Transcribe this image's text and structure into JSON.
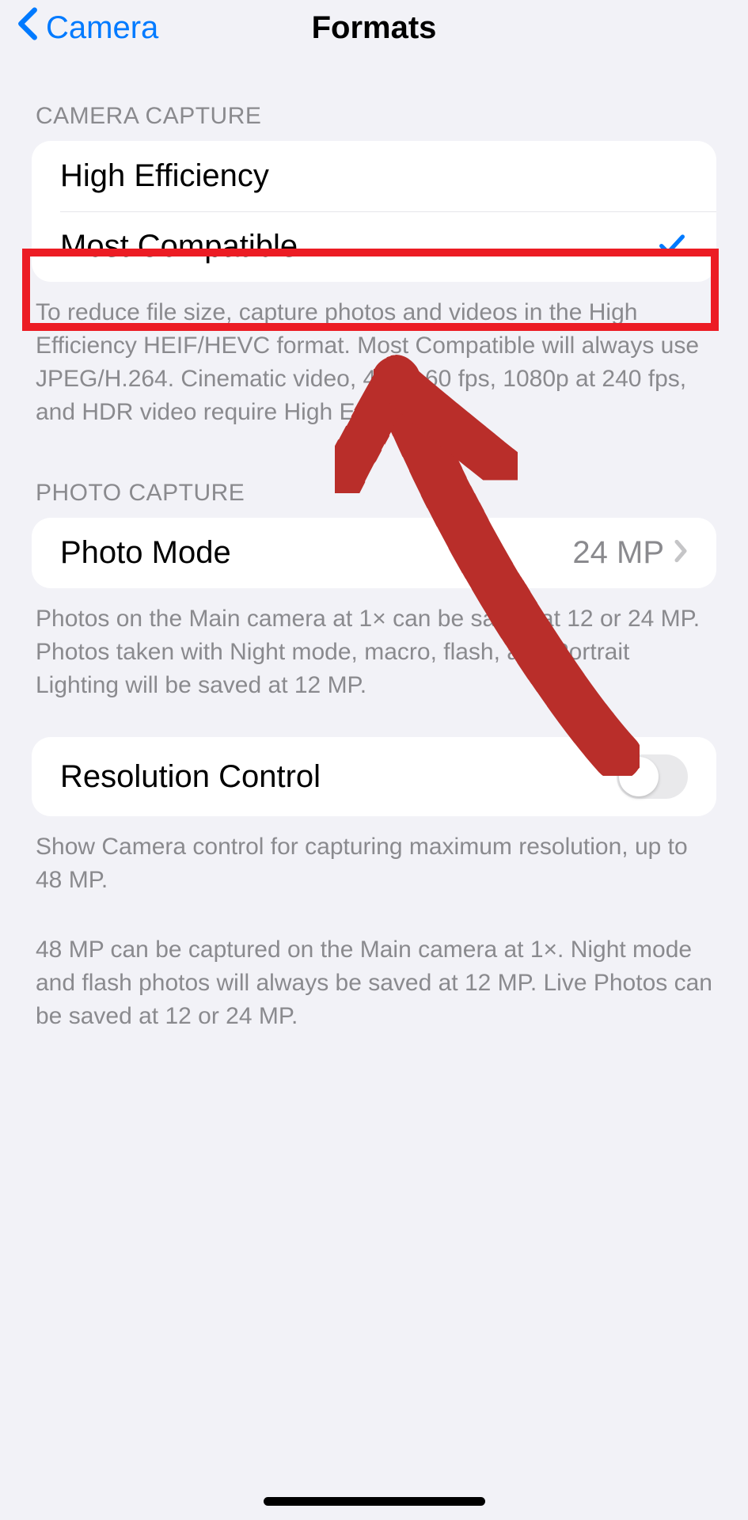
{
  "nav": {
    "back_label": "Camera",
    "title": "Formats"
  },
  "sections": {
    "cameraCapture": {
      "header": "CAMERA CAPTURE",
      "option_high_efficiency": "High Efficiency",
      "option_most_compatible": "Most Compatible",
      "footer": "To reduce file size, capture photos and videos in the High Efficiency HEIF/HEVC format. Most Compatible will always use JPEG/H.264. Cinematic video, 4K at 60 fps, 1080p at 240 fps, and HDR video require High Efficiency."
    },
    "photoCapture": {
      "header": "PHOTO CAPTURE",
      "photo_mode_label": "Photo Mode",
      "photo_mode_value": "24 MP",
      "footer": "Photos on the Main camera at 1× can be saved at 12 or 24 MP. Photos taken with Night mode, macro, flash, and Portrait Lighting will be saved at 12 MP."
    },
    "resolution": {
      "label": "Resolution Control",
      "footer1": "Show Camera control for capturing maximum resolution, up to 48 MP.",
      "footer2": "48 MP can be captured on the Main camera at 1×. Night mode and flash photos will always be saved at 12 MP. Live Photos can be saved at 12 or 24 MP."
    }
  },
  "annotations": {
    "highlight_target": "most-compatible-row"
  }
}
